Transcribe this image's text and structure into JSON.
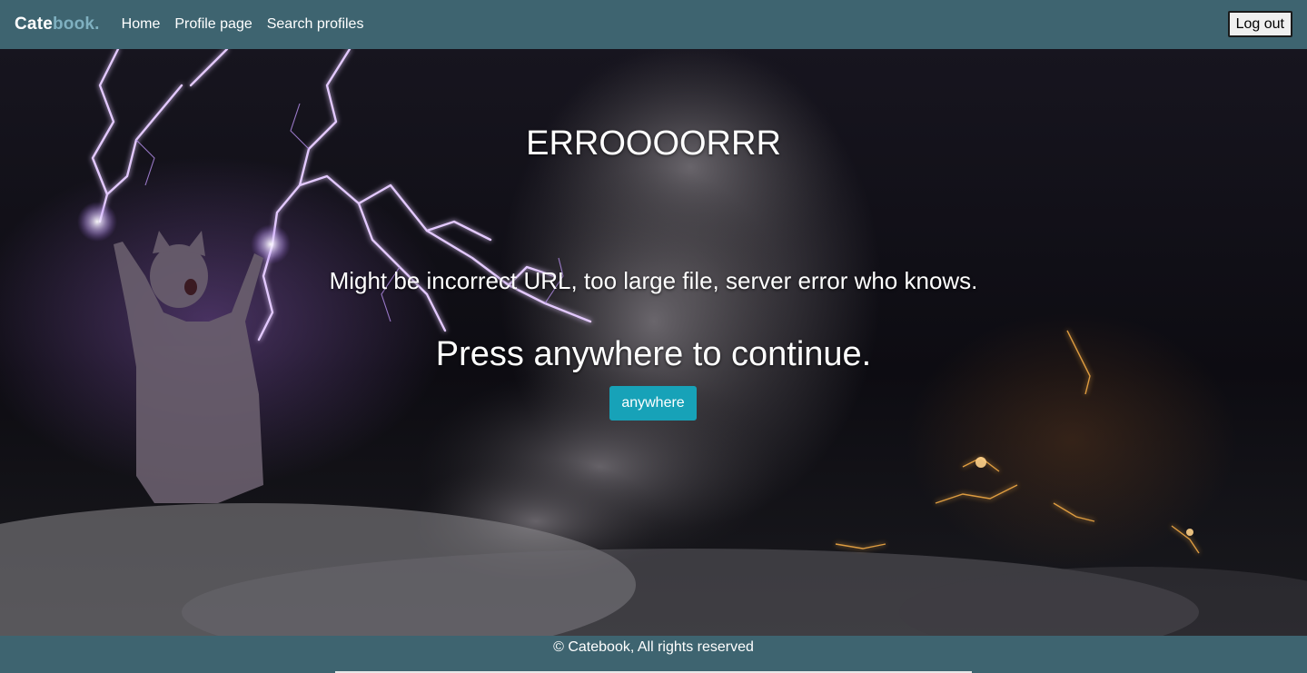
{
  "navbar": {
    "brand_main": "Cate",
    "brand_accent": "book.",
    "links": [
      "Home",
      "Profile page",
      "Search profiles"
    ],
    "logout_label": "Log out"
  },
  "hero": {
    "title": "ERROOOORRR",
    "message": "Might be incorrect URL, too large file, server error who knows.",
    "press": "Press anywhere to continue.",
    "button_label": "anywhere"
  },
  "footer": {
    "text": "© Catebook, All rights reserved"
  },
  "colors": {
    "navbar_bg": "#3e6470",
    "brand_accent": "#7fb0c0",
    "button_bg": "#17a2b8"
  },
  "icons": {
    "background": "storm-cat-lightning-image"
  }
}
